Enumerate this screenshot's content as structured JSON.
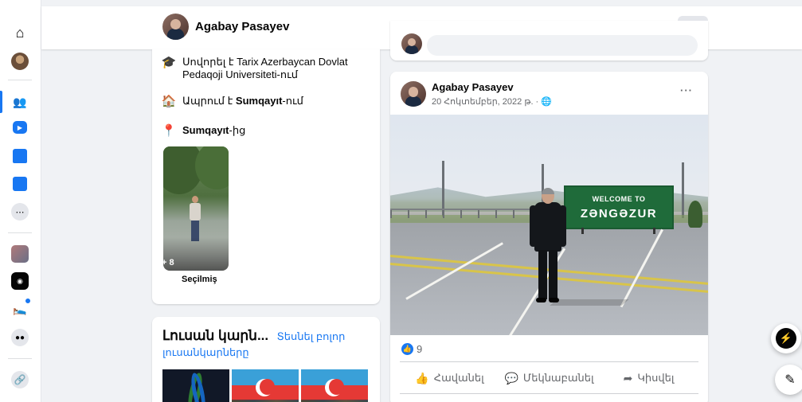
{
  "header": {
    "profile_name": "Agabay Pasayev",
    "more_label": "···"
  },
  "rail": {
    "items": [
      "home-icon",
      "profile-icon",
      "friends-icon",
      "watch-icon",
      "marketplace-icon",
      "gaming-icon",
      "menu-grid-icon",
      "group-avatar-icon",
      "app-icon",
      "notification-bed-icon",
      "groups-icon",
      "link-icon"
    ]
  },
  "intro": {
    "education_prefix": "Սովորել է ",
    "education_school": "Tarix Azerbaycan Dovlat Pedaqoji Universiteti-ում",
    "lives_prefix": "Ապրում է ",
    "lives_city": "Sumqayıt",
    "lives_suffix": "-ում",
    "from_city": "Sumqayıt",
    "from_suffix": "-ից",
    "featured_count": "+ 8",
    "featured_caption": "Seçilmiş"
  },
  "photos": {
    "title": "Լուսան կարն...",
    "see_all": "Տեսնել բոլոր լուսանկարները"
  },
  "post": {
    "author": "Agabay Pasayev",
    "date": "20 Հոկտեմբեր, 2022 թ. · ",
    "more_label": "···",
    "sign_line1": "WELCOME TO",
    "sign_line2": "ZƏNGƏZUR",
    "reaction_count": "9",
    "actions": {
      "like": "Հավանել",
      "comment": "Մեկնաբանել",
      "share": "Կիսվել"
    }
  },
  "colors": {
    "accent": "#1877f2",
    "background": "#f0f2f5",
    "sign_green": "#1f6b3a"
  }
}
